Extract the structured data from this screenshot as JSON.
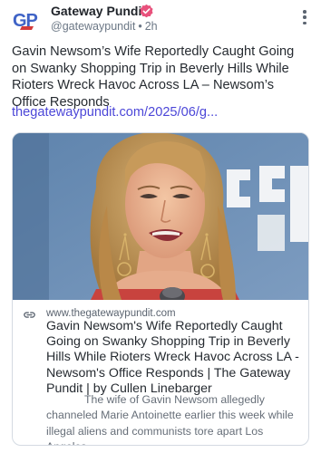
{
  "post": {
    "author": {
      "display_name": "Gateway Pundit",
      "handle": "@gatewaypundit",
      "separator": "•",
      "timestamp": "2h",
      "avatar_text": "GP",
      "verified": true
    },
    "text": "Gavin Newsom’s Wife Reportedly Caught Going on Swanky Shopping Trip in Beverly Hills While Rioters Wreck Havoc Across LA – Newsom’s Office Responds",
    "link_text": "thegatewaypundit.com/2025/06/g...",
    "icons": {
      "verified": "verified-badge-icon",
      "menu": "more-vertical-icon",
      "link": "link-icon"
    },
    "colors": {
      "accent": "#4c47d8",
      "verified": "#e8517c",
      "avatar_blue": "#3f63c6",
      "avatar_red": "#d33a3a"
    },
    "card": {
      "domain": "www.thegatewaypundit.com",
      "title": "Gavin Newsom's Wife Reportedly Caught Going on Swanky Shopping Trip in Beverly Hills While Rioters Wreck Havoc Across LA - Newsom's Office Responds | The Gateway Pundit | by Cullen Linebarger",
      "description": "The wife of Gavin Newsom allegedly channeled Marie Antoinette earlier this week while illegal aliens and communists tore apart Los Angeles."
    }
  }
}
